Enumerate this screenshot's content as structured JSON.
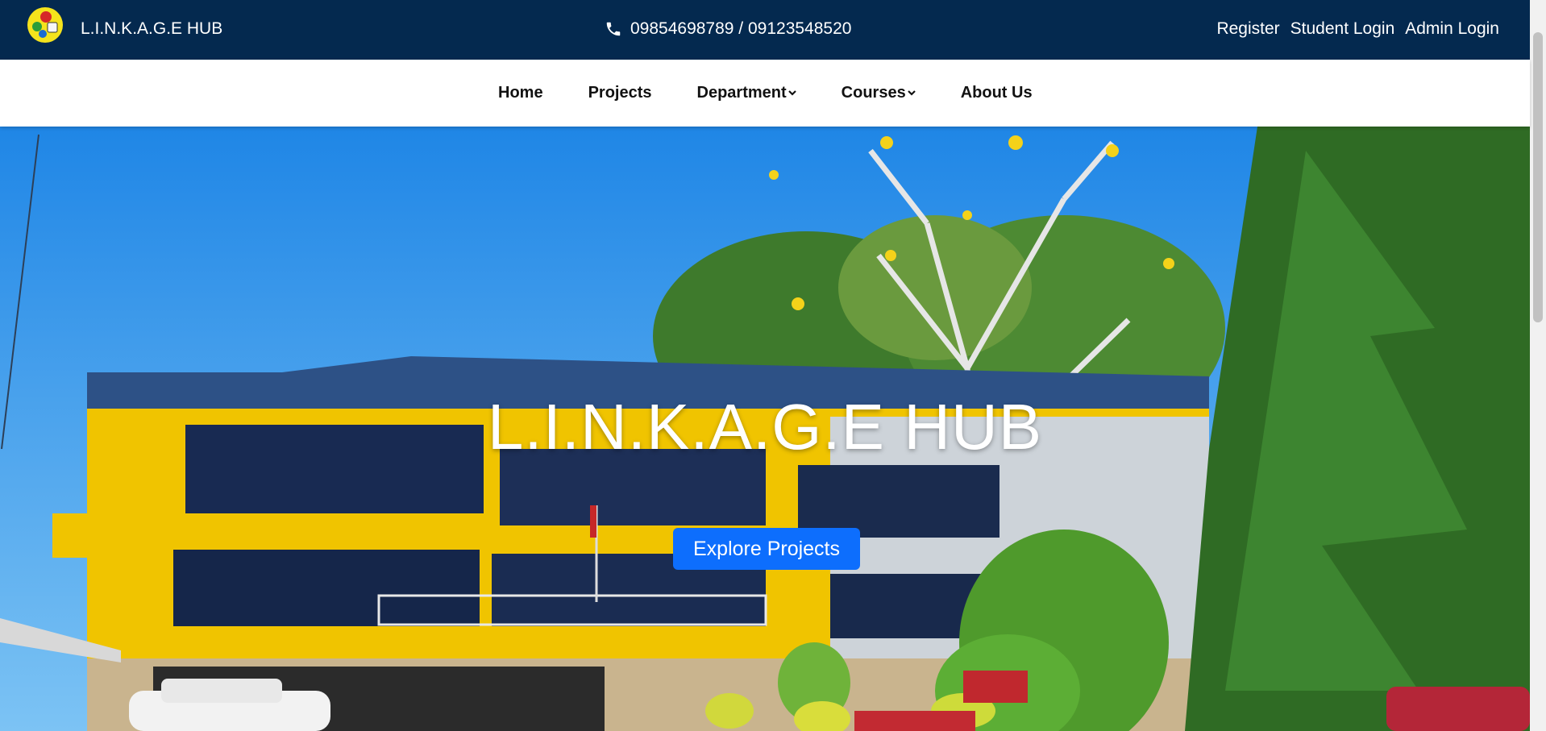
{
  "header": {
    "brand": "L.I.N.K.A.G.E HUB",
    "phone": "09854698789 / 09123548520",
    "links": [
      "Register",
      "Student Login",
      "Admin Login"
    ]
  },
  "nav": {
    "items": [
      {
        "label": "Home",
        "dropdown": false
      },
      {
        "label": "Projects",
        "dropdown": false
      },
      {
        "label": "Department",
        "dropdown": true
      },
      {
        "label": "Courses",
        "dropdown": true
      },
      {
        "label": "About Us",
        "dropdown": false
      }
    ]
  },
  "hero": {
    "title": "L.I.N.K.A.G.E HUB",
    "button": "Explore Projects"
  },
  "colors": {
    "topbar": "#04294f",
    "button": "#0d6efd",
    "building": "#f0c400"
  },
  "icons": [
    "logo-icon",
    "phone-icon",
    "chevron-down-icon"
  ]
}
